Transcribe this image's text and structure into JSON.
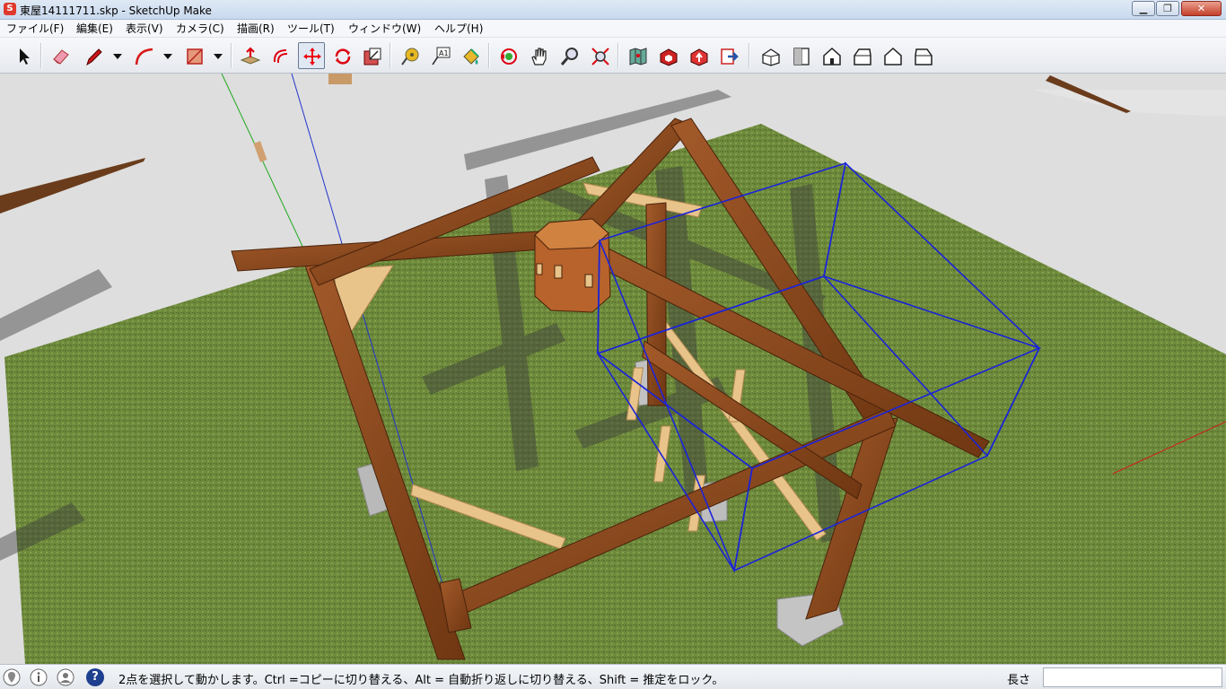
{
  "window": {
    "title": "東屋14111711.skp - SketchUp Make",
    "app_icon": "S",
    "min_symbol": "▁",
    "max_symbol": "❐",
    "close_symbol": "✕"
  },
  "menu": {
    "file": "ファイル(F)",
    "edit": "編集(E)",
    "view": "表示(V)",
    "camera": "カメラ(C)",
    "draw": "描画(R)",
    "tools": "ツール(T)",
    "window": "ウィンドウ(W)",
    "help": "ヘルプ(H)"
  },
  "toolbar": {
    "tools": [
      {
        "name": "select",
        "icon": "cursor-icon"
      },
      {
        "name": "eraser",
        "icon": "eraser-icon"
      },
      {
        "name": "line",
        "icon": "pencil-icon"
      },
      {
        "name": "arc",
        "icon": "arc-icon"
      },
      {
        "name": "rectangle",
        "icon": "rectangle-icon"
      },
      {
        "name": "push-pull",
        "icon": "push-pull-icon"
      },
      {
        "name": "offset",
        "icon": "offset-icon"
      },
      {
        "name": "move",
        "icon": "move-icon",
        "active": true
      },
      {
        "name": "rotate",
        "icon": "rotate-icon"
      },
      {
        "name": "scale",
        "icon": "scale-icon"
      },
      {
        "name": "tape-measure",
        "icon": "tape-measure-icon"
      },
      {
        "name": "text",
        "icon": "text-icon"
      },
      {
        "name": "paint-bucket",
        "icon": "paint-bucket-icon"
      },
      {
        "name": "orbit",
        "icon": "orbit-icon"
      },
      {
        "name": "pan",
        "icon": "hand-icon"
      },
      {
        "name": "zoom",
        "icon": "magnifier-icon"
      },
      {
        "name": "zoom-extents",
        "icon": "zoom-extents-icon"
      },
      {
        "name": "add-location",
        "icon": "map-icon"
      },
      {
        "name": "3d-warehouse",
        "icon": "warehouse-icon"
      },
      {
        "name": "share-model",
        "icon": "share-model-icon"
      },
      {
        "name": "extension-warehouse",
        "icon": "extension-icon"
      },
      {
        "name": "iso-view",
        "icon": "iso-house-icon"
      },
      {
        "name": "top-view",
        "icon": "top-view-icon"
      },
      {
        "name": "front-view",
        "icon": "front-view-icon"
      },
      {
        "name": "right-view",
        "icon": "right-view-icon"
      },
      {
        "name": "back-view",
        "icon": "back-view-icon"
      },
      {
        "name": "left-view",
        "icon": "left-view-icon"
      }
    ]
  },
  "status": {
    "text": "2点を選択して動かします。Ctrl =コピーに切り替える、Alt = 自動折り返しに切り替える、Shift = 推定をロック。",
    "measure_label": "長さ",
    "measure_value": "",
    "help_icon_text": "?"
  },
  "colors": {
    "wood": "#8b4a22",
    "wood_light": "#e8c48a",
    "grass": "#6d8a3a",
    "ground_gray": "#dcdcdc",
    "selection": "#1a23d9",
    "axis_red": "#d41b1b",
    "axis_green": "#1fa81f",
    "axis_blue": "#2233cc"
  }
}
